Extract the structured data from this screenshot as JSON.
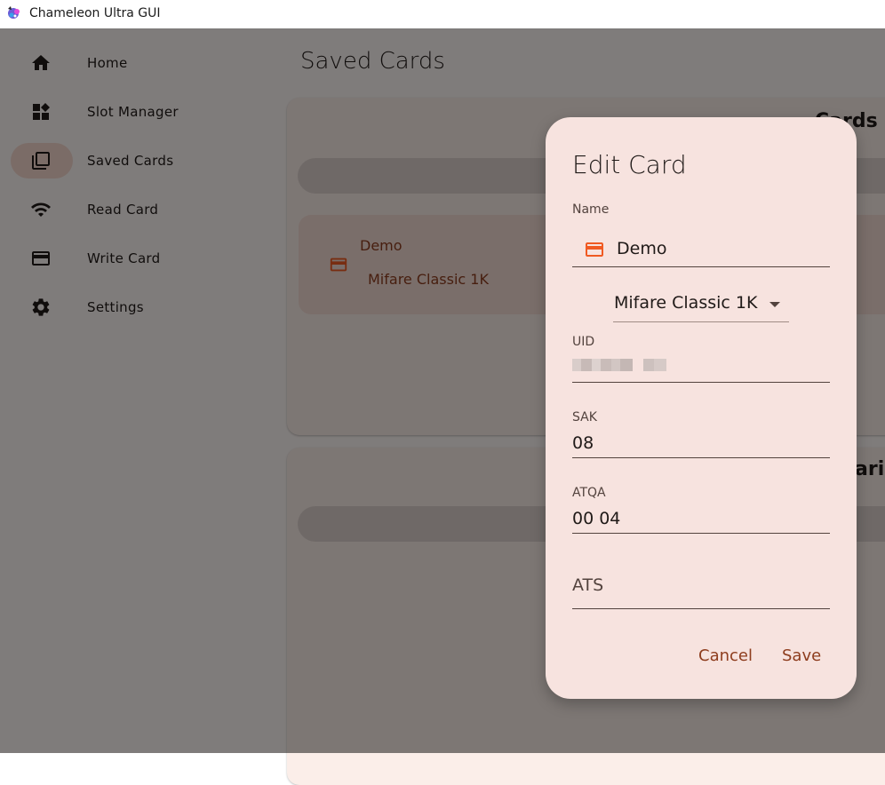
{
  "window": {
    "title": "Chameleon Ultra GUI"
  },
  "sidebar": {
    "items": [
      {
        "label": "Home",
        "icon": "home-icon"
      },
      {
        "label": "Slot Manager",
        "icon": "dashboard-icon"
      },
      {
        "label": "Saved Cards",
        "icon": "library-icon",
        "selected": true
      },
      {
        "label": "Read Card",
        "icon": "wifi-icon"
      },
      {
        "label": "Write Card",
        "icon": "credit-card-icon"
      },
      {
        "label": "Settings",
        "icon": "gear-icon"
      }
    ]
  },
  "main": {
    "title": "Saved Cards",
    "cards_heading_partial": "Cards",
    "dictionaries_heading_partial": "ari",
    "card": {
      "name": "Demo",
      "type": "Mifare Classic 1K"
    }
  },
  "dialog": {
    "title": "Edit Card",
    "name_label": "Name",
    "name_value": "Demo",
    "card_type": "Mifare Classic 1K",
    "uid_label": "UID",
    "sak_label": "SAK",
    "sak_value": "08",
    "atqa_label": "ATQA",
    "atqa_value": "00 04",
    "ats_placeholder": "ATS",
    "cancel_label": "Cancel",
    "save_label": "Save"
  },
  "colors": {
    "accent": "#8e3d1e",
    "icon_orange": "#f05a22",
    "dialog_bg": "#f7e3df"
  }
}
